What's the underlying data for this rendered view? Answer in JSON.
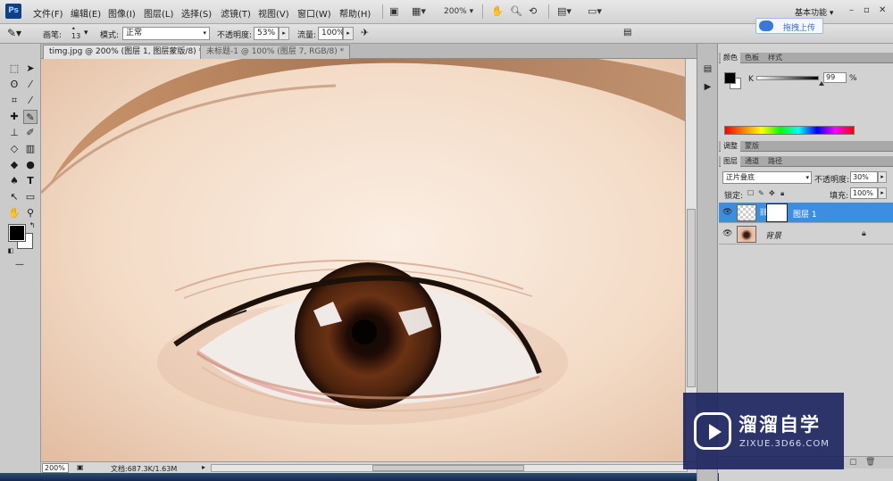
{
  "app": {
    "logo_text": "Ps",
    "menu": [
      "文件(F)",
      "编辑(E)",
      "图像(I)",
      "图层(L)",
      "选择(S)",
      "滤镜(T)",
      "视图(V)",
      "窗口(W)",
      "帮助(H)"
    ],
    "zoom_display": "200%",
    "workspace": "基本功能",
    "upload_label": "拖拽上传"
  },
  "options": {
    "brush_label": "画笔:",
    "brush_size": "13",
    "mode_label": "模式:",
    "mode_value": "正常",
    "opacity_label": "不透明度:",
    "opacity_value": "53%",
    "flow_label": "流量:",
    "flow_value": "100%"
  },
  "tabs": [
    {
      "label": "timg.jpg @ 200% (图层 1, 图层蒙版/8) *",
      "active": true
    },
    {
      "label": "未标题-1 @ 100% (图层 7, RGB/8) *",
      "active": false
    }
  ],
  "status": {
    "zoom": "200%",
    "doc_size": "文档:687.3K/1.63M"
  },
  "color_panel": {
    "tabs": [
      "颜色",
      "色板",
      "样式"
    ],
    "channel_label": "K",
    "channel_value": "99",
    "unit": "%",
    "black_level": 0.99
  },
  "adjust_panel": {
    "tabs": [
      "调整",
      "蒙版"
    ]
  },
  "layers_panel": {
    "tabs": [
      "图层",
      "通道",
      "路径"
    ],
    "blend_mode": "正片叠底",
    "opacity_label": "不透明度:",
    "opacity_value": "30%",
    "lock_label": "锁定:",
    "fill_label": "填充:",
    "fill_value": "100%",
    "layers": [
      {
        "name": "图层 1",
        "selected": true,
        "has_mask": true,
        "locked": false
      },
      {
        "name": "背景",
        "selected": false,
        "has_mask": false,
        "locked": true
      }
    ]
  },
  "watermark": {
    "title": "溜溜自学",
    "url": "ZIXUE.3D66.COM"
  },
  "colors": {
    "selection_blue": "#3d8ee0",
    "ps_blue": "#0f3f85",
    "watermark_bg": "#141e5a"
  },
  "icons": {
    "tools": [
      "marquee-icon",
      "move-icon",
      "lasso-icon",
      "magic-wand-icon",
      "crop-icon",
      "eyedropper-icon",
      "healing-icon",
      "brush-icon",
      "clone-stamp-icon",
      "history-brush-icon",
      "eraser-icon",
      "gradient-icon",
      "blur-icon",
      "dodge-icon",
      "pen-icon",
      "type-icon",
      "path-select-icon",
      "shape-icon",
      "hand-icon",
      "zoom-icon"
    ]
  }
}
